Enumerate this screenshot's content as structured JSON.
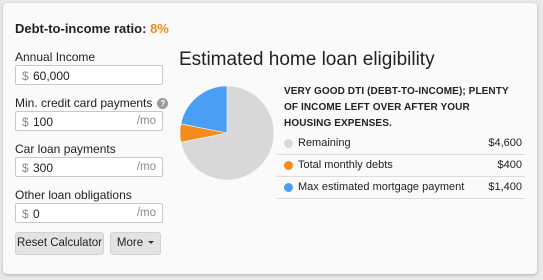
{
  "dti": {
    "label": "Debt-to-income ratio:",
    "value": "8%"
  },
  "fields": [
    {
      "label": "Annual Income",
      "prefix": "$",
      "value": "60,000",
      "suffix": ""
    },
    {
      "label": "Min. credit card payments",
      "prefix": "$",
      "value": "100",
      "suffix": "/mo",
      "help_icon": "question-icon"
    },
    {
      "label": "Car loan payments",
      "prefix": "$",
      "value": "300",
      "suffix": "/mo"
    },
    {
      "label": "Other loan obligations",
      "prefix": "$",
      "value": "0",
      "suffix": "/mo"
    }
  ],
  "buttons": {
    "reset": "Reset Calculator",
    "more": "More"
  },
  "results": {
    "heading": "Estimated home loan eligibility",
    "summary": "Very good DTI (debt-to-income); plenty of income left over after your housing expenses."
  },
  "legend": [
    {
      "label": "Remaining",
      "amount": "$4,600",
      "color": "#d8d8d8"
    },
    {
      "label": "Total monthly debts",
      "amount": "$400",
      "color": "#f28c1c"
    },
    {
      "label": "Max estimated mortgage payment",
      "amount": "$1,400",
      "color": "#4a9ff5"
    }
  ],
  "chart_data": {
    "type": "pie",
    "categories": [
      "Remaining",
      "Total monthly debts",
      "Max estimated mortgage payment"
    ],
    "values": [
      4600,
      400,
      1400
    ],
    "colors": [
      "#d8d8d8",
      "#f28c1c",
      "#4a9ff5"
    ]
  }
}
